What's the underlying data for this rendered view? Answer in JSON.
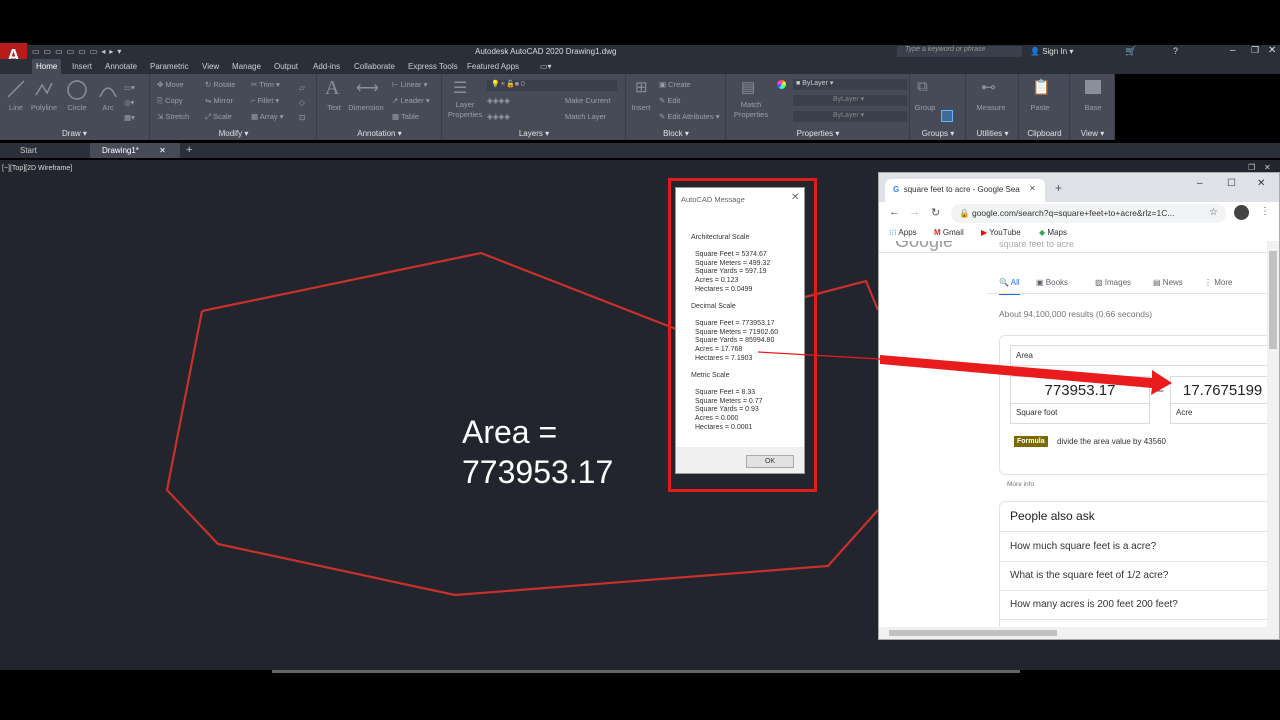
{
  "autocad": {
    "title": "Autodesk AutoCAD 2020   Drawing1.dwg",
    "search_placeholder": "Type a keyword or phrase",
    "sign_in": "Sign In",
    "ribbon_tabs": [
      "Home",
      "Insert",
      "Annotate",
      "Parametric",
      "View",
      "Manage",
      "Output",
      "Add-ins",
      "Collaborate",
      "Express Tools",
      "Featured Apps"
    ],
    "panels": {
      "draw": {
        "label": "Draw",
        "tools": [
          "Line",
          "Polyline",
          "Circle",
          "Arc"
        ]
      },
      "modify": {
        "label": "Modify",
        "tools": [
          "Move",
          "Rotate",
          "Trim",
          "Copy",
          "Mirror",
          "Fillet",
          "Stretch",
          "Scale",
          "Array"
        ]
      },
      "annotation": {
        "label": "Annotation",
        "tools": [
          "Text",
          "Dimension",
          "Linear",
          "Leader",
          "Table"
        ]
      },
      "layers": {
        "label": "Layers",
        "tools": [
          "Layer Properties",
          "Make Current",
          "Match Layer"
        ],
        "layer_value": "0"
      },
      "block": {
        "label": "Block",
        "tools": [
          "Insert",
          "Create",
          "Edit",
          "Edit Attributes"
        ]
      },
      "properties": {
        "label": "Properties",
        "tools": [
          "Match Properties"
        ],
        "bylayer": "ByLayer"
      },
      "groups": {
        "label": "Groups",
        "tool": "Group"
      },
      "utilities": {
        "label": "Utilities",
        "tool": "Measure"
      },
      "clipboard": {
        "label": "Clipboard",
        "tool": "Paste"
      },
      "view": {
        "label": "View",
        "tool": "Base"
      }
    },
    "doc_tabs": {
      "start": "Start",
      "drawing": "Drawing1*",
      "new_tab": "+"
    },
    "viewport_label": "[−][Top][2D Wireframe]",
    "area_text": {
      "line1": "Area =",
      "line2": "773953.17"
    },
    "polygon_color": "#c8312b"
  },
  "message": {
    "title": "AutoCAD Message",
    "sections": [
      {
        "heading": "Architectural Scale",
        "lines": [
          "Square Feet = 5374.67",
          "Square Meters = 499.32",
          "Square Yards = 597.19",
          "Acres = 0.123",
          "Hectares = 0.0499"
        ]
      },
      {
        "heading": "Decimal Scale",
        "lines": [
          "Square Feet = 773953.17",
          "Square Meters = 71902.60",
          "Square Yards = 85994.80",
          "Acres = 17.768",
          "Hectares = 7.1903"
        ]
      },
      {
        "heading": "Metric Scale",
        "lines": [
          "Square Feet = 8.33",
          "Square Meters = 0.77",
          "Square Yards = 0.93",
          "Acres = 0.000",
          "Hectares = 0.0001"
        ]
      }
    ],
    "ok": "OK"
  },
  "browser": {
    "tab_title": "square feet to acre - Google Sea",
    "url": "google.com/search?q=square+feet+to+acre&rlz=1C...",
    "bookmarks": [
      "Apps",
      "Gmail",
      "YouTube",
      "Maps"
    ],
    "search_query": "square feet to acre",
    "search_tabs": [
      "All",
      "Books",
      "Images",
      "News",
      "More"
    ],
    "result_stats": "About 94,100,000 results (0.66 seconds)",
    "converter": {
      "category": "Area",
      "from_value": "773953.17",
      "equals": "=",
      "to_value": "17.7675199",
      "from_unit": "Square foot",
      "to_unit": "Acre",
      "formula_badge": "Formula",
      "formula_text": "divide the area value by 43560",
      "more_info": "More info"
    },
    "paa_title": "People also ask",
    "paa_questions": [
      "How much square feet is a acre?",
      "What is the square feet of 1/2 acre?",
      "How many acres is 200 feet 200 feet?"
    ]
  },
  "colors": {
    "highlight_red": "#e21b1b",
    "arrow_red": "#e81c1c",
    "autocad_dark": "#22252d"
  }
}
